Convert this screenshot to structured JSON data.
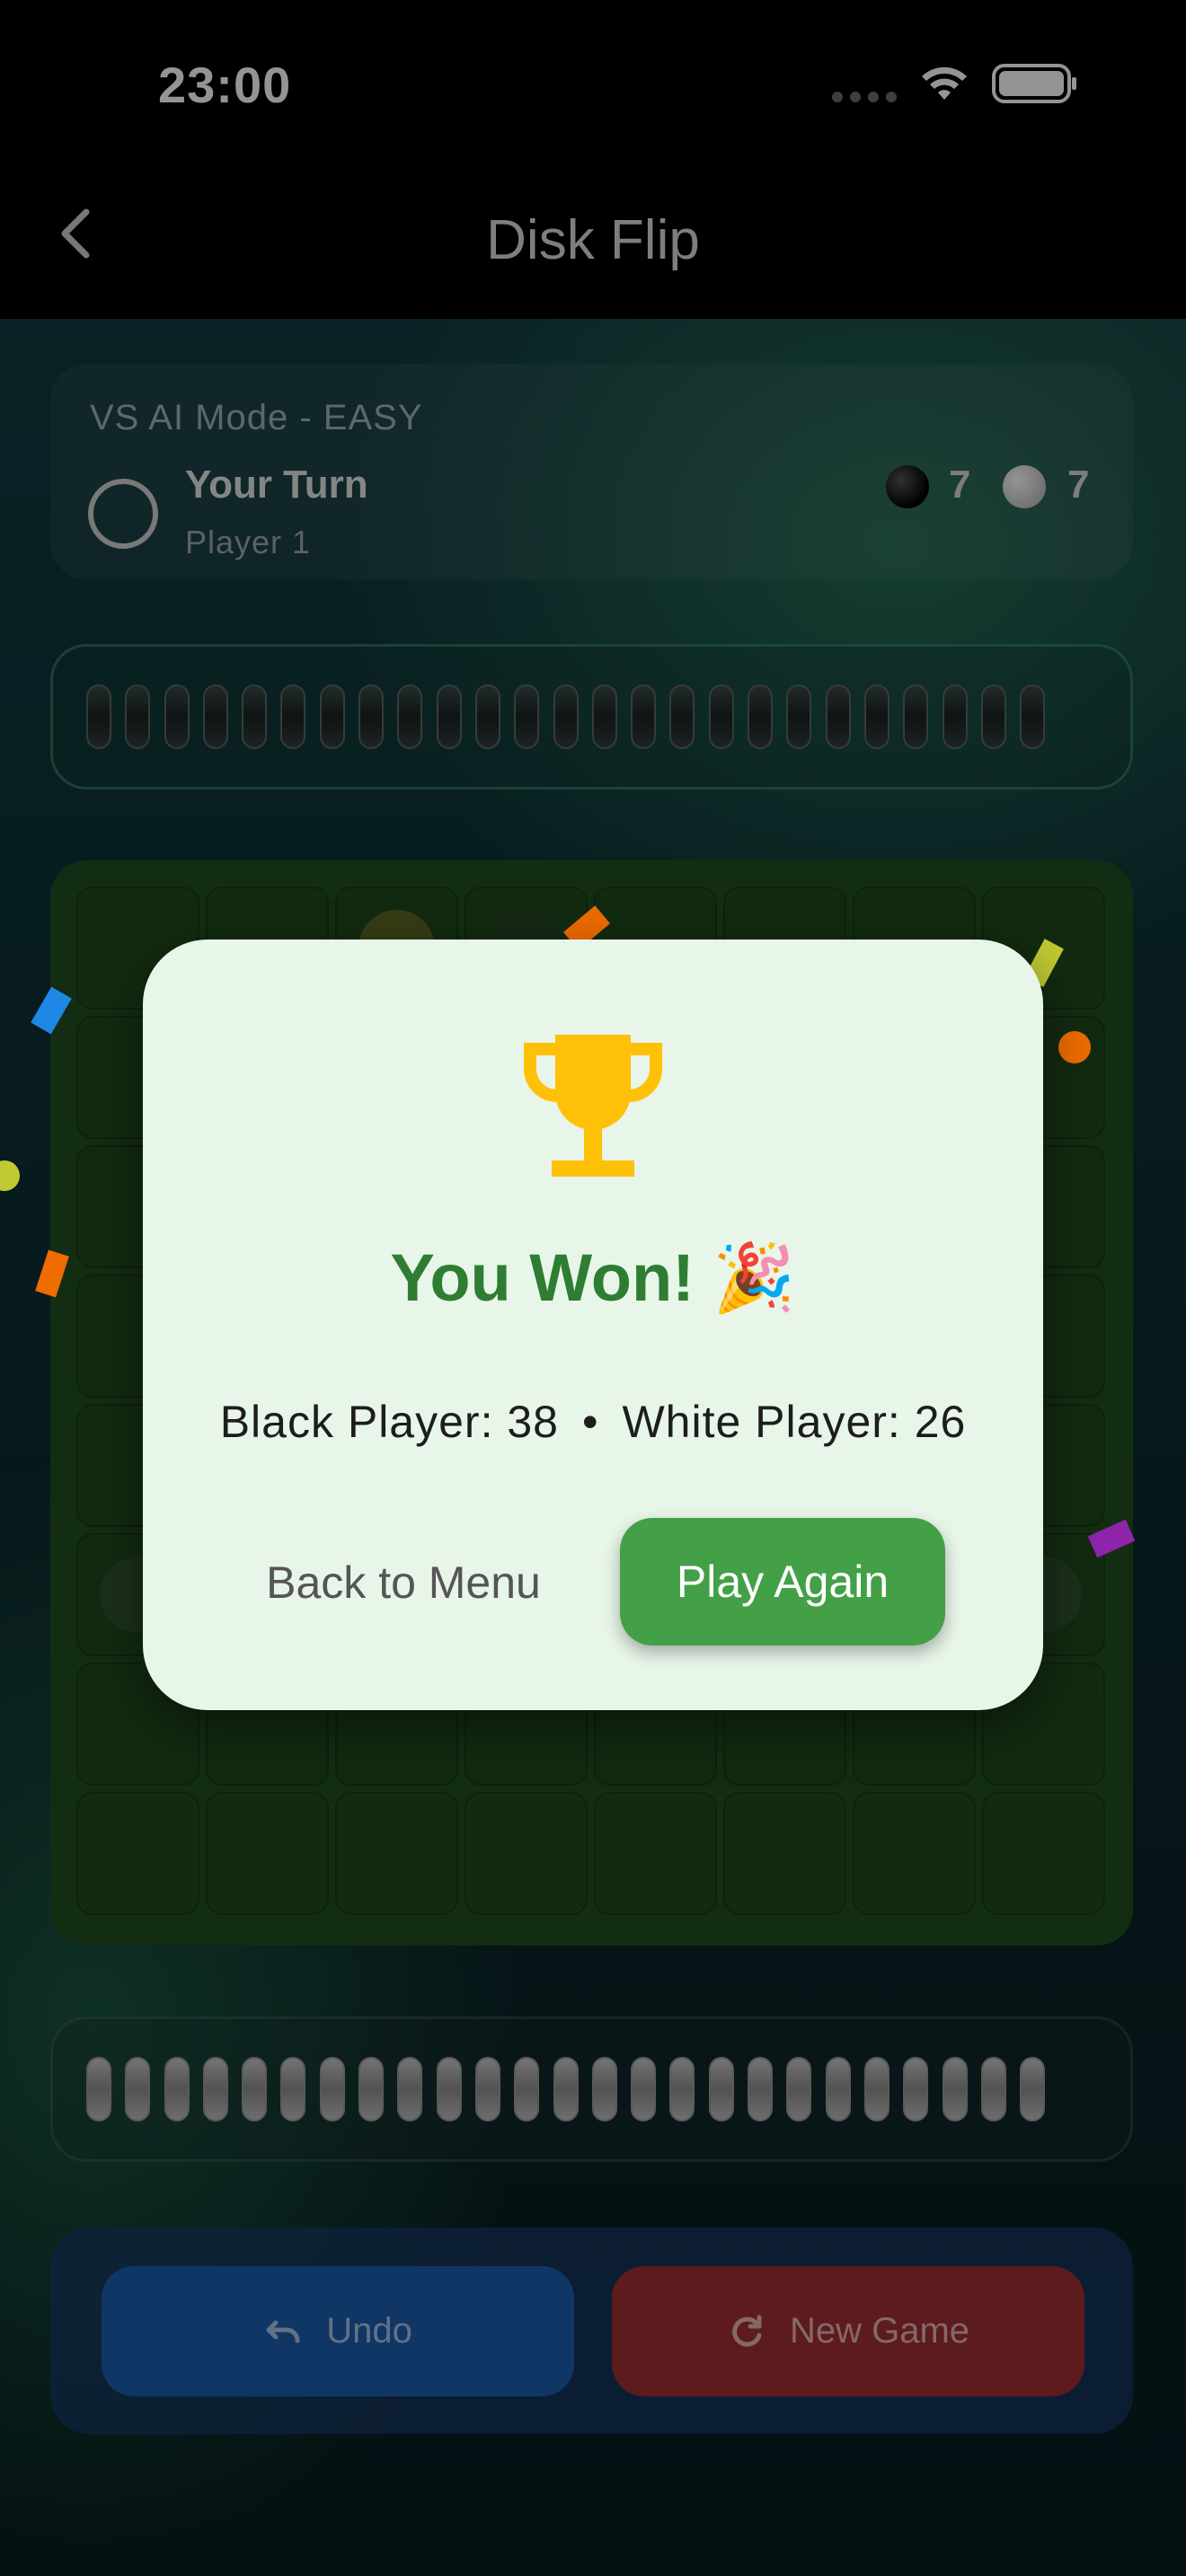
{
  "status_bar": {
    "time": "23:00"
  },
  "nav": {
    "title": "Disk Flip",
    "back_icon": "chevron-left-icon"
  },
  "game": {
    "mode_label": "VS AI Mode - EASY",
    "turn_title": "Your Turn",
    "turn_player": "Player 1",
    "black_count": "7",
    "white_count": "7",
    "tray_disks_per_tray": 25
  },
  "controls": {
    "undo_label": "Undo",
    "new_game_label": "New Game"
  },
  "dialog": {
    "title": "You Won!",
    "party_emoji": "🎉",
    "black_score": "Black Player: 38",
    "separator": "•",
    "white_score": "White Player: 26",
    "back_to_menu_label": "Back to Menu",
    "play_again_label": "Play Again"
  },
  "colors": {
    "accent_green": "#43a047",
    "title_green": "#2e7d32",
    "trophy_gold": "#ffc107",
    "undo_blue": "#1d5db0",
    "new_game_red": "#a12f33"
  }
}
